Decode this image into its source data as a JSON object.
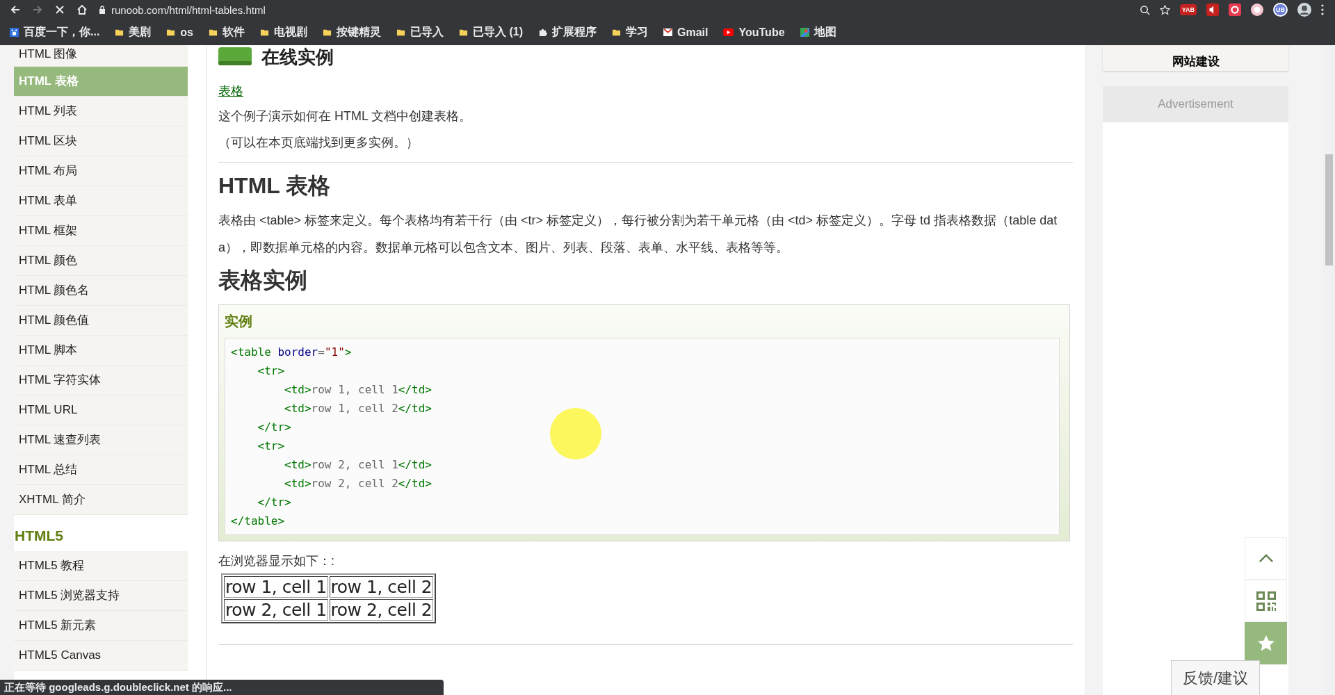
{
  "browser": {
    "url": "runoob.com/html/html-tables.html",
    "bookmarks": [
      {
        "kind": "baidu",
        "label": "百度一下，你..."
      },
      {
        "kind": "folder",
        "label": "美剧"
      },
      {
        "kind": "folder",
        "label": "os"
      },
      {
        "kind": "folder",
        "label": "软件"
      },
      {
        "kind": "folder",
        "label": "电视剧"
      },
      {
        "kind": "folder",
        "label": "按键精灵"
      },
      {
        "kind": "folder",
        "label": "已导入"
      },
      {
        "kind": "folder",
        "label": "已导入 (1)"
      },
      {
        "kind": "puzzle",
        "label": "扩展程序"
      },
      {
        "kind": "folder",
        "label": "学习"
      },
      {
        "kind": "mail",
        "label": "Gmail"
      },
      {
        "kind": "video",
        "label": "YouTube"
      },
      {
        "kind": "map",
        "label": "地图"
      }
    ],
    "extension_badges": [
      "YAB",
      "UB"
    ],
    "status": "正在等待 googleads.g.doubleclick.net 的响应..."
  },
  "sidebar": {
    "items": [
      {
        "label": "HTML 图像",
        "selected": false
      },
      {
        "label": "HTML 表格",
        "selected": true
      },
      {
        "label": "HTML 列表",
        "selected": false
      },
      {
        "label": "HTML 区块",
        "selected": false
      },
      {
        "label": "HTML 布局",
        "selected": false
      },
      {
        "label": "HTML 表单",
        "selected": false
      },
      {
        "label": "HTML 框架",
        "selected": false
      },
      {
        "label": "HTML 颜色",
        "selected": false
      },
      {
        "label": "HTML 颜色名",
        "selected": false
      },
      {
        "label": "HTML 颜色值",
        "selected": false
      },
      {
        "label": "HTML 脚本",
        "selected": false
      },
      {
        "label": "HTML 字符实体",
        "selected": false
      },
      {
        "label": "HTML URL",
        "selected": false
      },
      {
        "label": "HTML 速查列表",
        "selected": false
      },
      {
        "label": "HTML 总结",
        "selected": false
      },
      {
        "label": "XHTML 简介",
        "selected": false
      }
    ],
    "section_title": "HTML5",
    "section_items": [
      {
        "label": "HTML5 教程",
        "selected": false
      },
      {
        "label": "HTML5 浏览器支持",
        "selected": false
      },
      {
        "label": "HTML5 新元素",
        "selected": false
      },
      {
        "label": "HTML5 Canvas",
        "selected": false
      }
    ]
  },
  "main": {
    "example_heading": "在线实例",
    "example_link": "表格",
    "example_desc": "这个例子演示如何在 HTML 文档中创建表格。",
    "example_note": "（可以在本页底端找到更多实例。）",
    "section_title": "HTML 表格",
    "paragraph": "表格由 <table> 标签来定义。每个表格均有若干行（由 <tr> 标签定义），每行被分割为若干单元格（由 <td> 标签定义）。字母 td 指表格数据（table data），即数据单元格的内容。数据单元格可以包含文本、图片、列表、段落、表单、水平线、表格等等。",
    "subheading": "表格实例",
    "example_box": {
      "title": "实例",
      "code": [
        [
          {
            "kind": "tag",
            "text": "<table"
          },
          {
            "kind": "attr",
            "text": " border"
          },
          {
            "kind": "punct",
            "text": "="
          },
          {
            "kind": "value",
            "text": "\"1\""
          },
          {
            "kind": "tag",
            "text": ">"
          }
        ],
        [
          {
            "kind": "tag",
            "text": "    <tr>"
          }
        ],
        [
          {
            "kind": "tag",
            "text": "        <td>"
          },
          {
            "kind": "text",
            "text": "row 1, cell 1"
          },
          {
            "kind": "tag",
            "text": "</td>"
          }
        ],
        [
          {
            "kind": "tag",
            "text": "        <td>"
          },
          {
            "kind": "text",
            "text": "row 1, cell 2"
          },
          {
            "kind": "tag",
            "text": "</td>"
          }
        ],
        [
          {
            "kind": "tag",
            "text": "    </tr>"
          }
        ],
        [
          {
            "kind": "tag",
            "text": "    <tr>"
          }
        ],
        [
          {
            "kind": "tag",
            "text": "        <td>"
          },
          {
            "kind": "text",
            "text": "row 2, cell 1"
          },
          {
            "kind": "tag",
            "text": "</td>"
          }
        ],
        [
          {
            "kind": "tag",
            "text": "        <td>"
          },
          {
            "kind": "text",
            "text": "row 2, cell 2"
          },
          {
            "kind": "tag",
            "text": "</td>"
          }
        ],
        [
          {
            "kind": "tag",
            "text": "    </tr>"
          }
        ],
        [
          {
            "kind": "tag",
            "text": "</table>"
          }
        ]
      ]
    },
    "result_label": "在浏览器显示如下：:",
    "result_table": [
      [
        "row 1, cell 1",
        "row 1, cell 2"
      ],
      [
        "row 2, cell 1",
        "row 2, cell 2"
      ]
    ]
  },
  "right": {
    "card_title": "网站建设",
    "ad_label": "Advertisement",
    "feedback": "反馈/建议"
  }
}
